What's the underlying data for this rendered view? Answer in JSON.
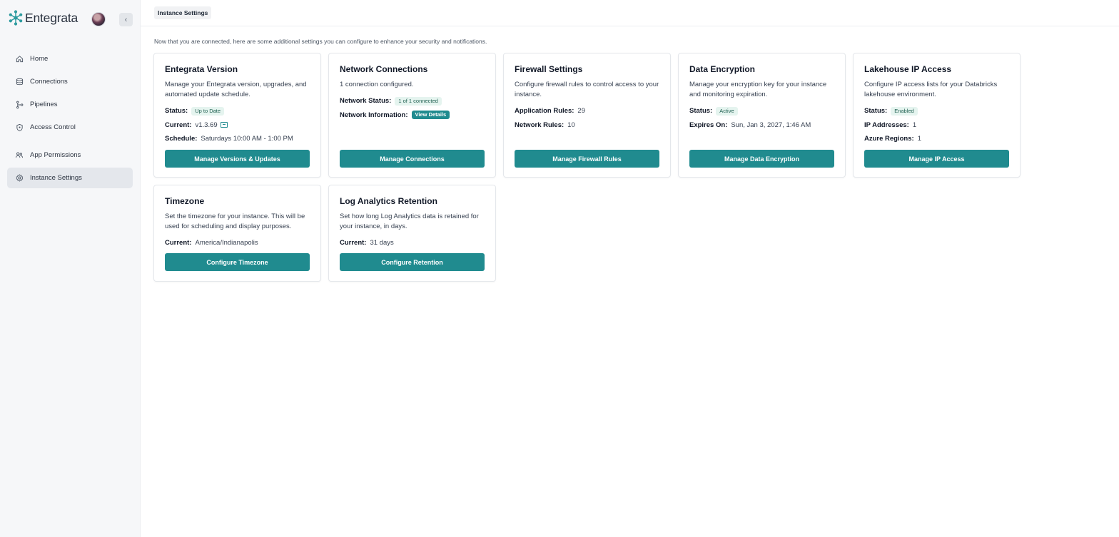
{
  "app": {
    "brand": "Entegrata",
    "collapse_glyph": "‹"
  },
  "sidebar": {
    "items": [
      {
        "label": "Home",
        "icon": "home-icon"
      },
      {
        "label": "Connections",
        "icon": "database-icon"
      },
      {
        "label": "Pipelines",
        "icon": "pipeline-icon"
      },
      {
        "label": "Access Control",
        "icon": "shield-icon"
      },
      {
        "label": "App Permissions",
        "icon": "users-icon"
      },
      {
        "label": "Instance Settings",
        "icon": "gear-icon",
        "active": true
      }
    ]
  },
  "header": {
    "tab": "Instance Settings"
  },
  "intro": "Now that you are connected, here are some additional settings you can configure to enhance your security and notifications.",
  "cards": {
    "version": {
      "title": "Entegrata Version",
      "desc": "Manage your Entegrata version, upgrades, and automated update schedule.",
      "status_label": "Status:",
      "status_value": "Up to Date",
      "current_label": "Current:",
      "current_value": "v1.3.69",
      "schedule_label": "Schedule:",
      "schedule_value": "Saturdays 10:00 AM - 1:00 PM",
      "button": "Manage Versions & Updates"
    },
    "network": {
      "title": "Network Connections",
      "desc": "1 connection configured.",
      "status_label": "Network Status:",
      "status_value": "1 of 1 connected",
      "info_label": "Network Information:",
      "info_value": "View Details",
      "button": "Manage Connections"
    },
    "firewall": {
      "title": "Firewall Settings",
      "desc": "Configure firewall rules to control access to your instance.",
      "app_rules_label": "Application Rules:",
      "app_rules_value": "29",
      "net_rules_label": "Network Rules:",
      "net_rules_value": "10",
      "button": "Manage Firewall Rules"
    },
    "encryption": {
      "title": "Data Encryption",
      "desc": "Manage your encryption key for your instance and monitoring expiration.",
      "status_label": "Status:",
      "status_value": "Active",
      "expires_label": "Expires On:",
      "expires_value": "Sun, Jan 3, 2027, 1:46 AM",
      "button": "Manage Data Encryption"
    },
    "lakehouse": {
      "title": "Lakehouse IP Access",
      "desc": "Configure IP access lists for your Databricks lakehouse environment.",
      "status_label": "Status:",
      "status_value": "Enabled",
      "ip_label": "IP Addresses:",
      "ip_value": "1",
      "regions_label": "Azure Regions:",
      "regions_value": "1",
      "button": "Manage IP Access"
    },
    "timezone": {
      "title": "Timezone",
      "desc": "Set the timezone for your instance. This will be used for scheduling and display purposes.",
      "current_label": "Current:",
      "current_value": "America/Indianapolis",
      "button": "Configure Timezone"
    },
    "retention": {
      "title": "Log Analytics Retention",
      "desc": "Set how long Log Analytics data is retained for your instance, in days.",
      "current_label": "Current:",
      "current_value": "31 days",
      "button": "Configure Retention"
    }
  },
  "colors": {
    "accent": "#208b8f",
    "badge_bg": "#e5f4ef",
    "sidebar_bg": "#f6f7f9"
  }
}
